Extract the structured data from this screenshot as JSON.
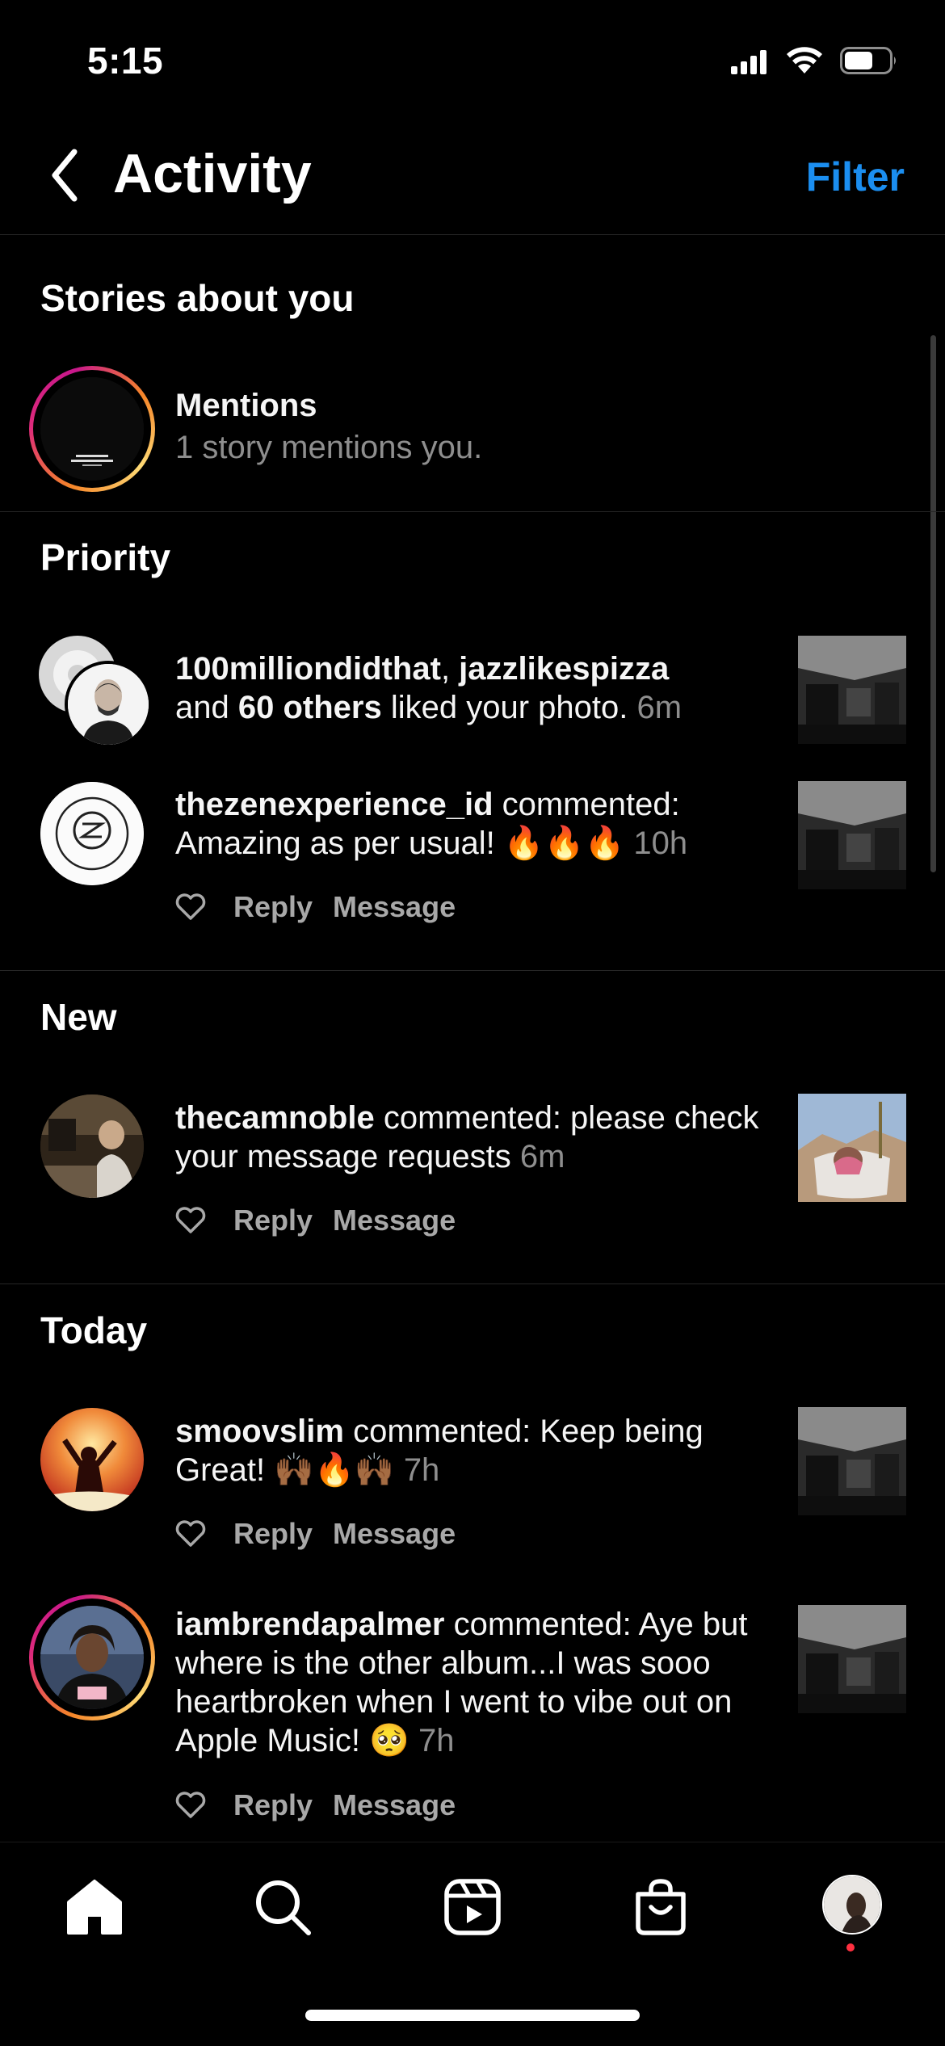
{
  "status_bar": {
    "time": "5:15"
  },
  "header": {
    "title": "Activity",
    "filter_label": "Filter"
  },
  "stories_section": {
    "title": "Stories about you",
    "mentions": {
      "title": "Mentions",
      "subtitle": "1 story mentions you."
    }
  },
  "priority_section": {
    "title": "Priority",
    "items": [
      {
        "user1": "100milliondidthat",
        "sep1": ", ",
        "user2": "jazzlikespizza",
        "and": "and ",
        "others": "60 others",
        "action": " liked your photo.",
        "time": "6m"
      },
      {
        "user": "thezenexperience_id",
        "action": " commented: Amazing as per usual! 🔥🔥🔥",
        "time": "10h",
        "reply": "Reply",
        "message": "Message"
      }
    ]
  },
  "new_section": {
    "title": "New",
    "items": [
      {
        "user": "thecamnoble",
        "action": " commented: please check your message requests",
        "time": "6m",
        "reply": "Reply",
        "message": "Message"
      }
    ]
  },
  "today_section": {
    "title": "Today",
    "items": [
      {
        "user": "smoovslim",
        "action": " commented: Keep being Great! 🙌🏾🔥🙌🏾",
        "time": "7h",
        "reply": "Reply",
        "message": "Message"
      },
      {
        "user": "iambrendapalmer",
        "action": " commented: Aye but where is the other album...I was sooo heartbroken when I went to vibe out on Apple Music! 🥺",
        "time": "7h",
        "reply": "Reply",
        "message": "Message"
      }
    ]
  },
  "colors": {
    "accent": "#1b8ef0",
    "notification": "#ff3040",
    "secondary_text": "#8e8e8e"
  },
  "tab_bar": {
    "icons": [
      "home-icon",
      "search-icon",
      "reels-icon",
      "shop-icon",
      "profile-avatar"
    ]
  }
}
